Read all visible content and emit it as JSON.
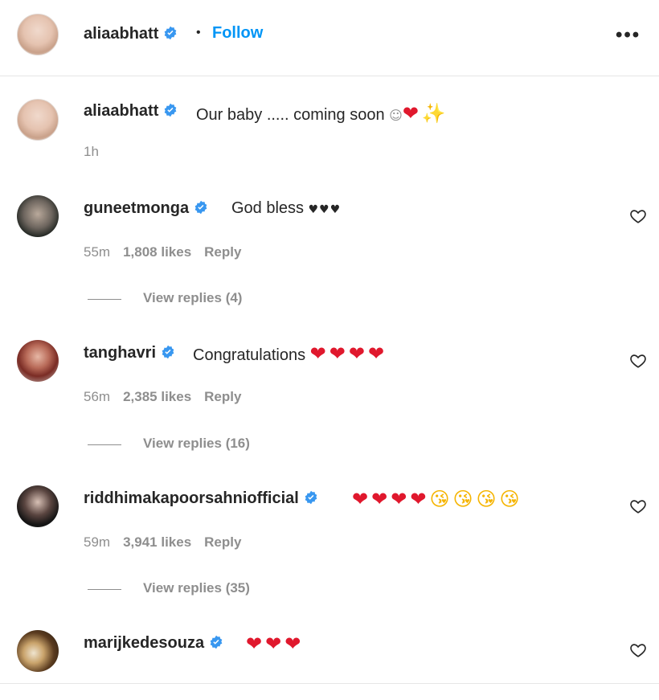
{
  "header": {
    "username": "aliaabhatt",
    "separator": "•",
    "follow_label": "Follow",
    "more_label": "•••"
  },
  "caption": {
    "username": "aliaabhatt",
    "text": "Our baby ..... coming soon ",
    "emojis_red": "❤",
    "emojis_sparkle": "✨",
    "time": "1h"
  },
  "comments": [
    {
      "username": "guneetmonga",
      "text": "God bless ",
      "emojis": "♥♥♥",
      "time": "55m",
      "likes": "1,808 likes",
      "reply_label": "Reply",
      "view_replies": "View replies (4)"
    },
    {
      "username": "tanghavri",
      "text": "Congratulations ",
      "emojis": "❤❤❤❤",
      "time": "56m",
      "likes": "2,385 likes",
      "reply_label": "Reply",
      "view_replies": "View replies (16)"
    },
    {
      "username": "riddhimakapoorsahniofficial",
      "text": "",
      "emojis": "❤❤❤❤",
      "emojis_face": "😘😘😘😘",
      "time": "59m",
      "likes": "3,941 likes",
      "reply_label": "Reply",
      "view_replies": "View replies (35)"
    },
    {
      "username": "marijkedesouza",
      "text": "",
      "emojis": "❤❤❤"
    }
  ],
  "colors": {
    "accent": "#0095f6",
    "verified": "#3897f0",
    "muted": "#8e8e8e",
    "heart": "#e0182d"
  }
}
